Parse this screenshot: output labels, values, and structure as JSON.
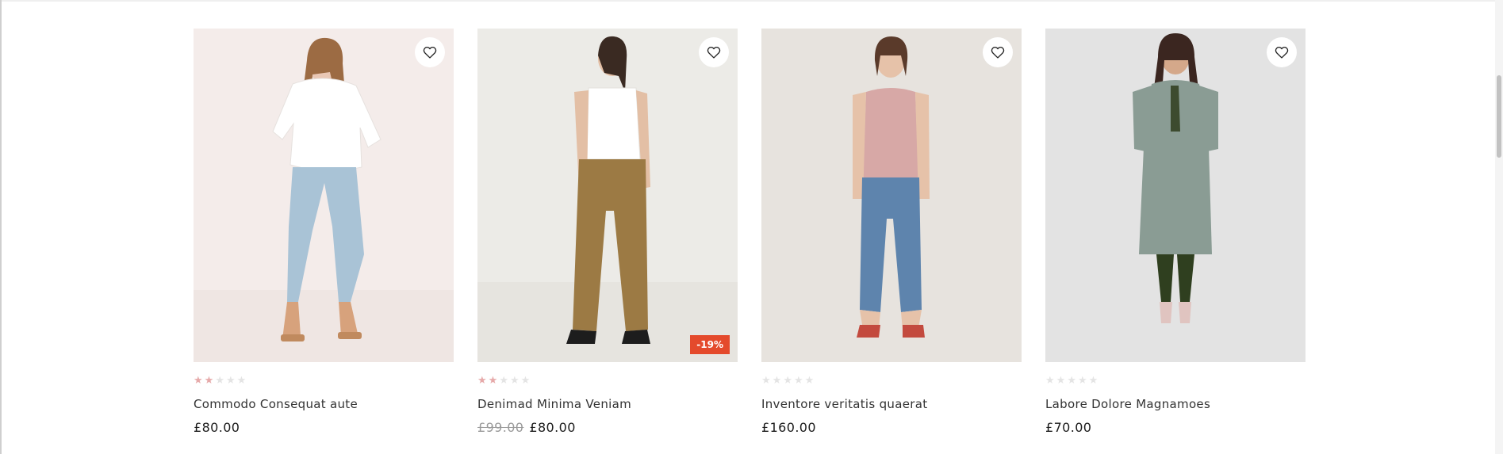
{
  "colors": {
    "badge_bg": "#e44a2c",
    "star_filled": "#e6a9a9",
    "star_empty": "#e4e4e4",
    "old_price": "#9a9a9a"
  },
  "products": [
    {
      "name": "Commodo Consequat aute",
      "rating": 2,
      "rating_max": 5,
      "price": "£80.00",
      "old_price": "",
      "badge": "",
      "wishlist_icon": "heart-outline-icon"
    },
    {
      "name": "Denimad Minima Veniam",
      "rating": 2,
      "rating_max": 5,
      "price": "£80.00",
      "old_price": "£99.00",
      "badge": "-19%",
      "wishlist_icon": "heart-outline-icon"
    },
    {
      "name": "Inventore veritatis quaerat",
      "rating": 0,
      "rating_max": 5,
      "price": "£160.00",
      "old_price": "",
      "badge": "",
      "wishlist_icon": "heart-outline-icon"
    },
    {
      "name": "Labore Dolore Magnamoes",
      "rating": 0,
      "rating_max": 5,
      "price": "£70.00",
      "old_price": "",
      "badge": "",
      "wishlist_icon": "heart-outline-icon"
    }
  ]
}
